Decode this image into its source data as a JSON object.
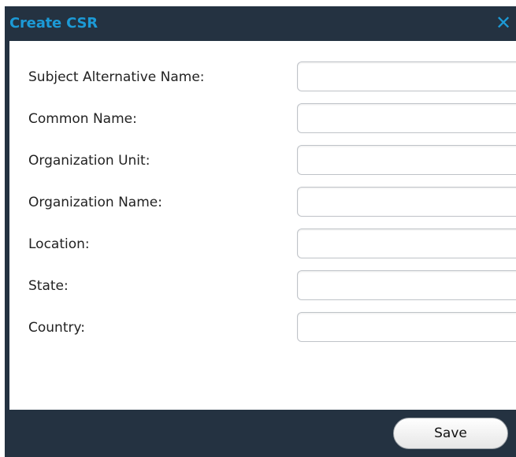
{
  "dialog": {
    "title": "Create CSR",
    "close_icon": "close-icon",
    "accent_color": "#1c9ad6",
    "frame_color": "#243241"
  },
  "form": {
    "fields": [
      {
        "label": "Subject Alternative Name:",
        "value": ""
      },
      {
        "label": "Common Name:",
        "value": ""
      },
      {
        "label": "Organization Unit:",
        "value": ""
      },
      {
        "label": "Organization Name:",
        "value": ""
      },
      {
        "label": "Location:",
        "value": ""
      },
      {
        "label": "State:",
        "value": ""
      },
      {
        "label": "Country:",
        "value": ""
      }
    ]
  },
  "footer": {
    "save_label": "Save"
  }
}
